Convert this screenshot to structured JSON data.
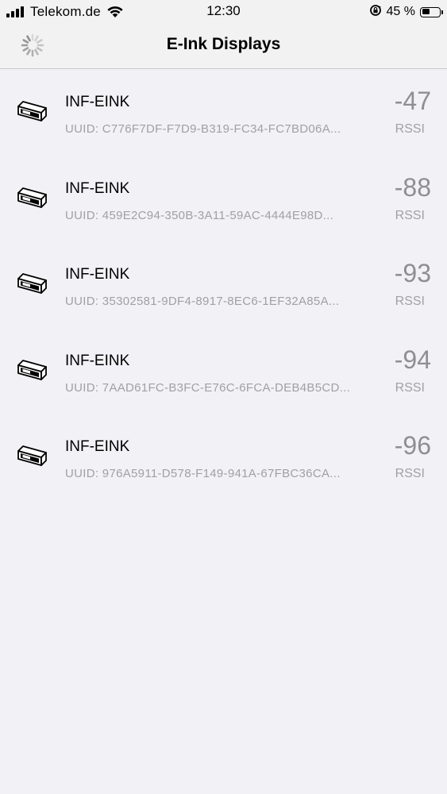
{
  "status_bar": {
    "carrier": "Telekom.de",
    "time": "12:30",
    "battery_percent": "45 %",
    "battery_level": 0.45,
    "signal_bars": 4,
    "icons": [
      "signal-icon",
      "wifi-icon",
      "orientation-lock-icon",
      "battery-icon"
    ]
  },
  "nav": {
    "title": "E-Ink Displays",
    "activity_indicator": "spinner-icon"
  },
  "devices": [
    {
      "name": "INF-EINK",
      "uuid": "UUID: C776F7DF-F7D9-B319-FC34-FC7BD06A...",
      "rssi": "-47",
      "rssi_label": "RSSI",
      "icon": "eink-display-icon"
    },
    {
      "name": "INF-EINK",
      "uuid": "UUID: 459E2C94-350B-3A11-59AC-4444E98D...",
      "rssi": "-88",
      "rssi_label": "RSSI",
      "icon": "eink-display-icon"
    },
    {
      "name": "INF-EINK",
      "uuid": "UUID: 35302581-9DF4-8917-8EC6-1EF32A85A...",
      "rssi": "-93",
      "rssi_label": "RSSI",
      "icon": "eink-display-icon"
    },
    {
      "name": "INF-EINK",
      "uuid": "UUID: 7AAD61FC-B3FC-E76C-6FCA-DEB4B5CD...",
      "rssi": "-94",
      "rssi_label": "RSSI",
      "icon": "eink-display-icon"
    },
    {
      "name": "INF-EINK",
      "uuid": "UUID: 976A5911-D578-F149-941A-67FBC36CA...",
      "rssi": "-96",
      "rssi_label": "RSSI",
      "icon": "eink-display-icon"
    }
  ],
  "colors": {
    "background": "#f2f1f6",
    "bar_background": "#f2f2f2",
    "secondary_text": "#a0a0a5",
    "rssi_value": "#8e8e93"
  }
}
